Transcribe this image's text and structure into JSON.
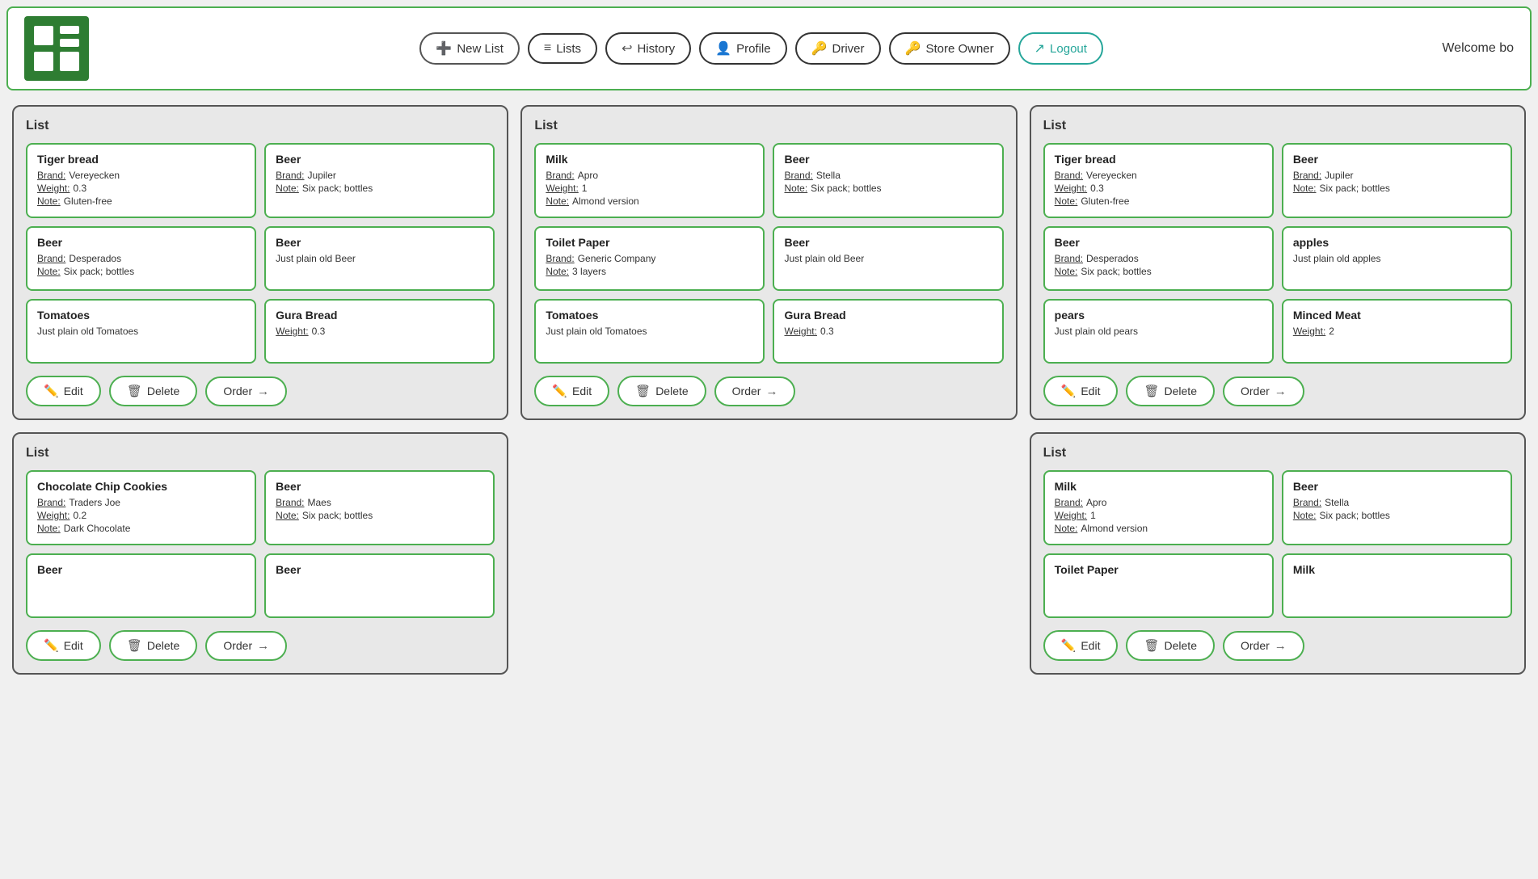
{
  "header": {
    "welcome": "Welcome bo",
    "nav": [
      {
        "id": "new-list",
        "label": "New List",
        "icon": "➕"
      },
      {
        "id": "lists",
        "label": "Lists",
        "icon": "☰"
      },
      {
        "id": "history",
        "label": "History",
        "icon": "↩"
      },
      {
        "id": "profile",
        "label": "Profile",
        "icon": "👤"
      },
      {
        "id": "driver",
        "label": "Driver",
        "icon": "🔑"
      },
      {
        "id": "store-owner",
        "label": "Store Owner",
        "icon": "🔑"
      },
      {
        "id": "logout",
        "label": "Logout",
        "icon": "↗",
        "special": "logout"
      }
    ]
  },
  "lists": [
    {
      "title": "List",
      "items": [
        {
          "name": "Tiger bread",
          "details": [
            {
              "label": "Brand:",
              "value": "Vereyecken"
            },
            {
              "label": "Weight:",
              "value": "0.3"
            },
            {
              "label": "Note:",
              "value": "Gluten-free"
            }
          ]
        },
        {
          "name": "Beer",
          "details": [
            {
              "label": "Brand:",
              "value": "Jupiler"
            },
            {
              "label": "Note:",
              "value": "Six pack; bottles"
            }
          ]
        },
        {
          "name": "Beer",
          "details": [
            {
              "label": "Brand:",
              "value": "Desperados"
            },
            {
              "label": "Note:",
              "value": "Six pack; bottles"
            }
          ]
        },
        {
          "name": "Beer",
          "details": [
            {
              "label": "",
              "value": "Just plain old Beer"
            }
          ]
        },
        {
          "name": "Tomatoes",
          "details": [
            {
              "label": "",
              "value": "Just plain old Tomatoes"
            }
          ]
        },
        {
          "name": "Gura Bread",
          "details": [
            {
              "label": "Weight:",
              "value": "0.3"
            }
          ]
        }
      ],
      "actions": [
        "Edit",
        "Delete",
        "Order"
      ]
    },
    {
      "title": "List",
      "items": [
        {
          "name": "Milk",
          "details": [
            {
              "label": "Brand:",
              "value": "Apro"
            },
            {
              "label": "Weight:",
              "value": "1"
            },
            {
              "label": "Note:",
              "value": "Almond version"
            }
          ]
        },
        {
          "name": "Beer",
          "details": [
            {
              "label": "Brand:",
              "value": "Stella"
            },
            {
              "label": "Note:",
              "value": "Six pack; bottles"
            }
          ]
        },
        {
          "name": "Toilet Paper",
          "details": [
            {
              "label": "Brand:",
              "value": "Generic Company"
            },
            {
              "label": "Note:",
              "value": "3 layers"
            }
          ]
        },
        {
          "name": "Beer",
          "details": [
            {
              "label": "",
              "value": "Just plain old Beer"
            }
          ]
        },
        {
          "name": "Tomatoes",
          "details": [
            {
              "label": "",
              "value": "Just plain old Tomatoes"
            }
          ]
        },
        {
          "name": "Gura Bread",
          "details": [
            {
              "label": "Weight:",
              "value": "0.3"
            }
          ]
        }
      ],
      "actions": [
        "Edit",
        "Delete",
        "Order"
      ]
    },
    {
      "title": "List",
      "items": [
        {
          "name": "Tiger bread",
          "details": [
            {
              "label": "Brand:",
              "value": "Vereyecken"
            },
            {
              "label": "Weight:",
              "value": "0.3"
            },
            {
              "label": "Note:",
              "value": "Gluten-free"
            }
          ]
        },
        {
          "name": "Beer",
          "details": [
            {
              "label": "Brand:",
              "value": "Jupiler"
            },
            {
              "label": "Note:",
              "value": "Six pack; bottles"
            }
          ]
        },
        {
          "name": "Beer",
          "details": [
            {
              "label": "Brand:",
              "value": "Desperados"
            },
            {
              "label": "Note:",
              "value": "Six pack; bottles"
            }
          ]
        },
        {
          "name": "apples",
          "details": [
            {
              "label": "",
              "value": "Just plain old apples"
            }
          ]
        },
        {
          "name": "pears",
          "details": [
            {
              "label": "",
              "value": "Just plain old pears"
            }
          ]
        },
        {
          "name": "Minced Meat",
          "details": [
            {
              "label": "Weight:",
              "value": "2"
            }
          ]
        }
      ],
      "actions": [
        "Edit",
        "Delete",
        "Order"
      ]
    },
    {
      "title": "List",
      "items": [
        {
          "name": "Chocolate Chip Cookies",
          "details": [
            {
              "label": "Brand:",
              "value": "Traders Joe"
            },
            {
              "label": "Weight:",
              "value": "0.2"
            },
            {
              "label": "Note:",
              "value": "Dark Chocolate"
            }
          ]
        },
        {
          "name": "Beer",
          "details": [
            {
              "label": "Brand:",
              "value": "Maes"
            },
            {
              "label": "Note:",
              "value": "Six pack; bottles"
            }
          ]
        },
        {
          "name": "Beer",
          "details": [
            {
              "label": "",
              "value": ""
            }
          ]
        },
        {
          "name": "Beer",
          "details": [
            {
              "label": "",
              "value": ""
            }
          ]
        }
      ],
      "actions": [
        "Edit",
        "Delete",
        "Order"
      ]
    },
    {
      "title": "",
      "items": [],
      "actions": []
    },
    {
      "title": "List",
      "items": [
        {
          "name": "Milk",
          "details": [
            {
              "label": "Brand:",
              "value": "Apro"
            },
            {
              "label": "Weight:",
              "value": "1"
            },
            {
              "label": "Note:",
              "value": "Almond version"
            }
          ]
        },
        {
          "name": "Beer",
          "details": [
            {
              "label": "Brand:",
              "value": "Stella"
            },
            {
              "label": "Note:",
              "value": "Six pack; bottles"
            }
          ]
        },
        {
          "name": "Toilet Paper",
          "details": [
            {
              "label": "",
              "value": ""
            }
          ]
        },
        {
          "name": "Milk",
          "details": [
            {
              "label": "",
              "value": ""
            }
          ]
        }
      ],
      "actions": [
        "Edit",
        "Delete",
        "Order"
      ]
    }
  ],
  "buttons": {
    "edit": "Edit",
    "delete": "Delete",
    "order": "Order"
  }
}
